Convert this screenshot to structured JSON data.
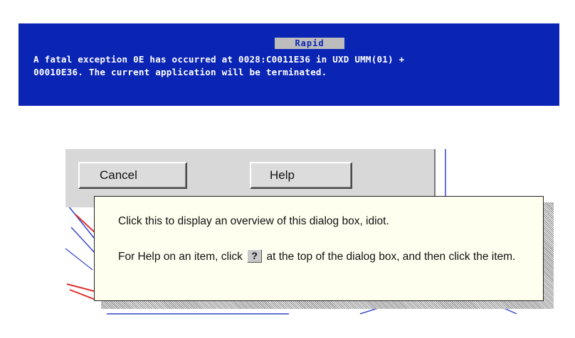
{
  "bsod": {
    "title": "Rapid",
    "message_line1": "A fatal exception 0E has occurred at 0028:C0011E36 in UXD UMM(01) +",
    "message_line2": "00010E36. The current application will be terminated.",
    "background_color": "#0a24b4",
    "title_bg_color": "#bdbdbd"
  },
  "dialog": {
    "cancel_label": "Cancel",
    "help_label": "Help"
  },
  "tooltip": {
    "line1": "Click this to display an overview of this dialog box, idiot.",
    "line2_before": "For Help on an item, click",
    "help_glyph": "?",
    "line2_after": "at the top of the dialog box, and then click the item.",
    "background_color": "#fffff0"
  }
}
